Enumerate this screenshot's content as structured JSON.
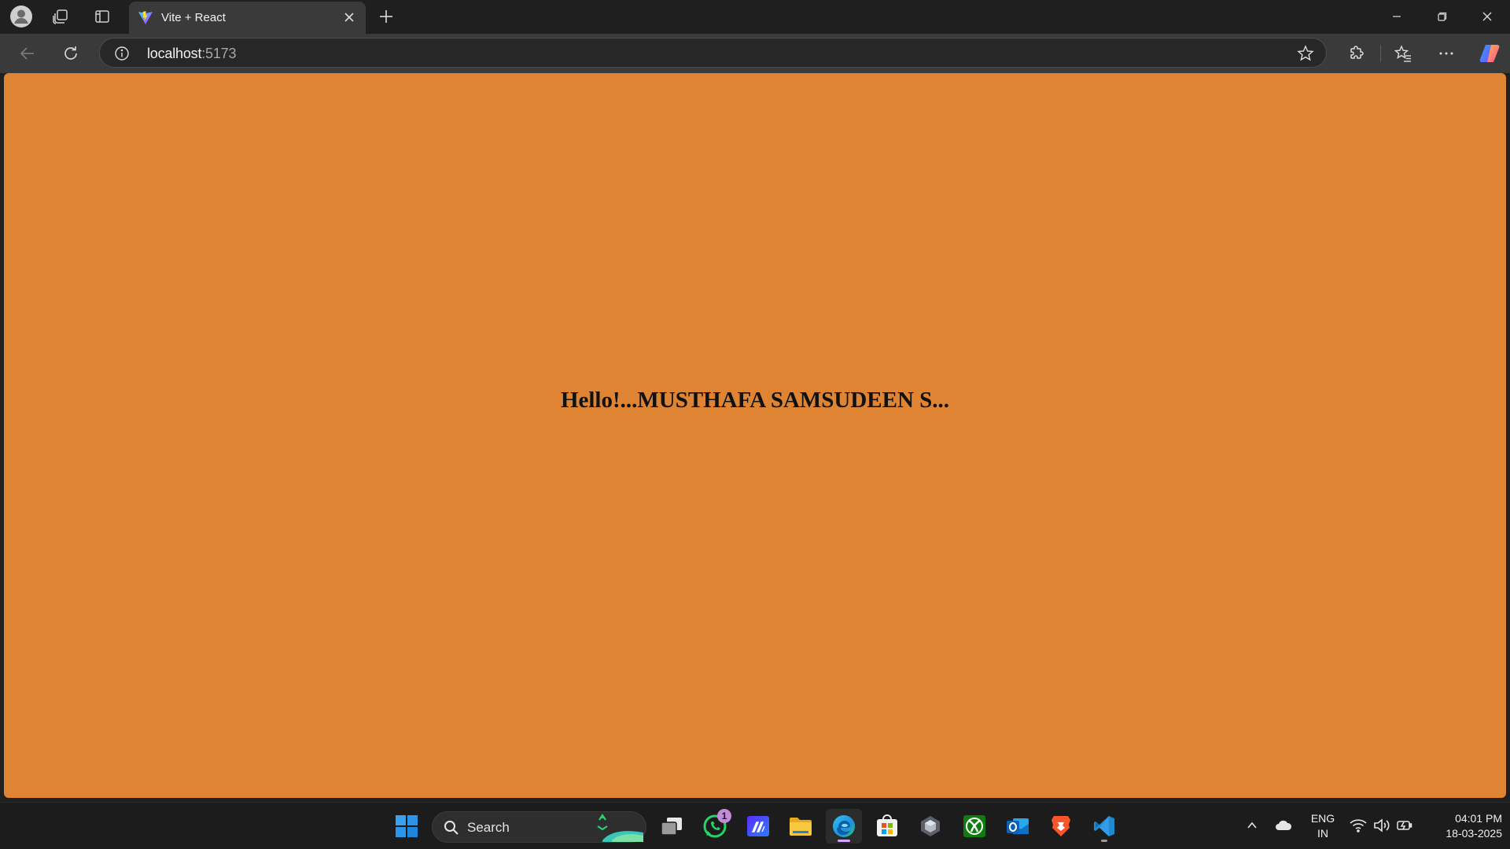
{
  "browser": {
    "tab": {
      "title": "Vite + React"
    },
    "address_bar": {
      "host": "localhost",
      "port": ":5173"
    }
  },
  "page": {
    "background_color": "#df8433",
    "greeting": "Hello!...MUSTHAFA SAMSUDEEN S..."
  },
  "taskbar": {
    "search_label": "Search",
    "whatsapp_badge": "1",
    "apps": [
      "start-icon",
      "task-view-icon",
      "whatsapp-icon",
      "powerapps-icon",
      "file-explorer-icon",
      "edge-icon",
      "store-icon",
      "app-icon",
      "xbox-icon",
      "outlook-icon",
      "brave-icon",
      "vscode-icon"
    ],
    "language": {
      "line1": "ENG",
      "line2": "IN"
    },
    "clock": {
      "time": "04:01 PM",
      "date": "18-03-2025"
    }
  }
}
